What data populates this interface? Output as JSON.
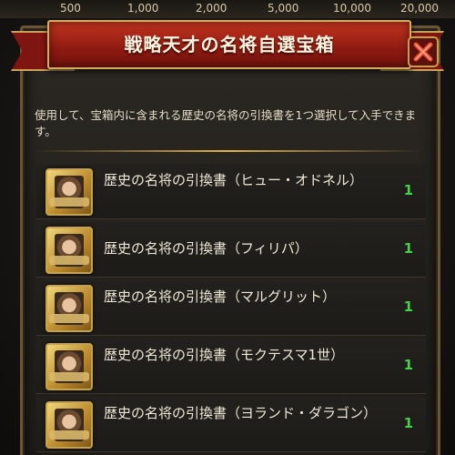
{
  "top_strip": [
    "500",
    "1,000",
    "2,000",
    "5,000",
    "10,000",
    "20,000"
  ],
  "dialog": {
    "title": "戦略天才の名将自選宝箱",
    "description": "使用して、宝箱内に含まれる歴史の名将の引換書を1つ選択して入手できます。"
  },
  "items": [
    {
      "label": "歴史の名将の引換書（ヒュー・オドネル）",
      "qty": "1",
      "icon": "hugh-odonnell-portrait-icon"
    },
    {
      "label": "歴史の名将の引換書（フィリパ）",
      "qty": "1",
      "icon": "philippa-portrait-icon"
    },
    {
      "label": "歴史の名将の引換書（マルグリット）",
      "qty": "1",
      "icon": "marguerite-portrait-icon"
    },
    {
      "label": "歴史の名将の引換書（モクテスマ1世）",
      "qty": "1",
      "icon": "moctezuma-portrait-icon"
    },
    {
      "label": "歴史の名将の引換書（ヨランド・ダラゴン）",
      "qty": "1",
      "icon": "yolande-portrait-icon"
    }
  ],
  "colors": {
    "ribbon": "#a8261a",
    "gold_border": "#d4ad62",
    "quantity": "#43d24a"
  }
}
